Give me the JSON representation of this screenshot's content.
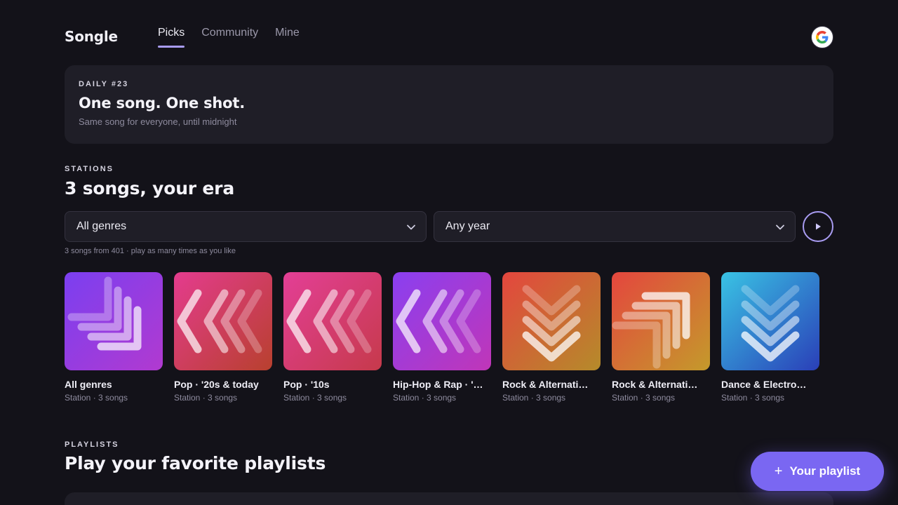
{
  "app": {
    "name": "Songle"
  },
  "nav": {
    "tabs": [
      {
        "label": "Picks",
        "active": true
      },
      {
        "label": "Community",
        "active": false
      },
      {
        "label": "Mine",
        "active": false
      }
    ],
    "signin_icon": "google-icon"
  },
  "daily": {
    "eyebrow": "DAILY #23",
    "title": "One song. One shot.",
    "subtitle": "Same song for everyone, until midnight"
  },
  "stations": {
    "eyebrow": "STATIONS",
    "title": "3 songs, your era",
    "genre_select": "All genres",
    "year_select": "Any year",
    "hint": "3 songs from 401 · play as many times as you like",
    "cards": [
      {
        "title": "All genres",
        "sub": "Station · 3 songs",
        "grad": [
          "#7b3ff0",
          "#b13ad0"
        ],
        "pattern": "corner-down"
      },
      {
        "title": "Pop · '20s & today",
        "sub": "Station · 3 songs",
        "grad": [
          "#e43c8e",
          "#b8402e"
        ],
        "pattern": "chevron-left"
      },
      {
        "title": "Pop · '10s",
        "sub": "Station · 3 songs",
        "grad": [
          "#e33f96",
          "#c63a4b"
        ],
        "pattern": "chevron-left"
      },
      {
        "title": "Hip-Hop & Rap · '…",
        "sub": "Station · 3 songs",
        "grad": [
          "#8a3ff0",
          "#c036b8"
        ],
        "pattern": "chevron-left"
      },
      {
        "title": "Rock & Alternati…",
        "sub": "Station · 3 songs",
        "grad": [
          "#e4463e",
          "#b58b2a"
        ],
        "pattern": "chevron-down"
      },
      {
        "title": "Rock & Alternati…",
        "sub": "Station · 3 songs",
        "grad": [
          "#e4463e",
          "#c49a2b"
        ],
        "pattern": "corner-up"
      },
      {
        "title": "Dance & Electro…",
        "sub": "Station · 3 songs",
        "grad": [
          "#39c3e4",
          "#2a3fb8"
        ],
        "pattern": "chevron-down"
      }
    ]
  },
  "playlists": {
    "eyebrow": "PLAYLISTS",
    "title": "Play your favorite playlists"
  },
  "fab": {
    "icon": "plus-icon",
    "label": "Your playlist"
  },
  "colors": {
    "accent": "#a99cf2",
    "fab": "#7a67f2",
    "background": "#131219",
    "card": "#1f1e27"
  }
}
